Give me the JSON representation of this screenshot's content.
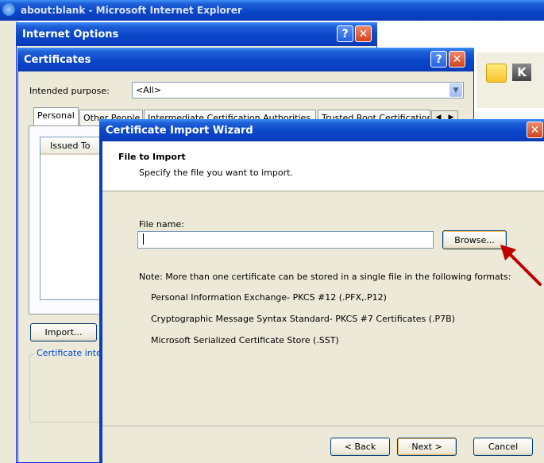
{
  "ie_window": {
    "title": "about:blank - Microsoft Internet Explorer"
  },
  "internet_options": {
    "title": "Internet Options",
    "help": "?",
    "close": "✕"
  },
  "certificates": {
    "title": "Certificates",
    "help": "?",
    "close": "✕",
    "intended_purpose_label": "Intended purpose:",
    "intended_purpose_value": "<All>",
    "tabs": [
      "Personal",
      "Other People",
      "Intermediate Certification Authorities",
      "Trusted Root Certification Authorities"
    ],
    "column_issued_to": "Issued To",
    "import_label": "Import...",
    "cert_intended_label": "Certificate intended purposes"
  },
  "wizard": {
    "title": "Certificate Import Wizard",
    "close": "✕",
    "heading": "File to Import",
    "subheading": "Specify the file you want to import.",
    "file_name_label": "File name:",
    "file_name_value": "",
    "browse_label": "Browse...",
    "note": "Note:  More than one certificate can be stored in a single file in the following formats:",
    "formats": [
      "Personal Information Exchange- PKCS #12 (.PFX,.P12)",
      "Cryptographic Message Syntax Standard- PKCS #7 Certificates (.P7B)",
      "Microsoft Serialized Certificate Store (.SST)"
    ],
    "back_label": "< Back",
    "next_label": "Next >",
    "cancel_label": "Cancel"
  },
  "colors": {
    "titlebar": "#0a46c9",
    "dialog_bg": "#ece9d8",
    "arrow": "#c00000"
  }
}
